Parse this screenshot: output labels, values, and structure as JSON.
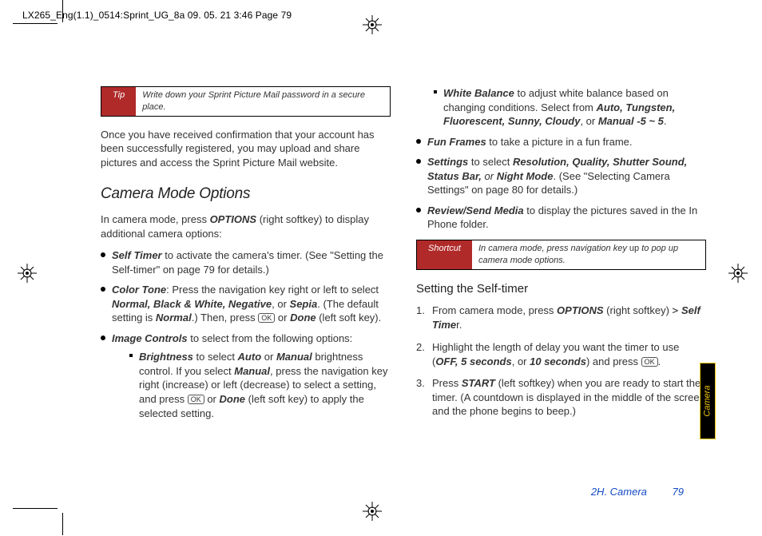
{
  "header_slug": "LX265_Eng(1.1)_0514:Sprint_UG_8a  09. 05. 21    3:46  Page 79",
  "tip": {
    "label": "Tip",
    "body": "Write down your Sprint Picture Mail password in a secure place."
  },
  "intro_para": "Once you have received confirmation that your account has been successfully registered, you may upload and share pictures and access the Sprint Picture Mail website.",
  "h2": "Camera Mode Options",
  "options_word": "OPTIONS",
  "cam_intro_a": "In camera mode, press ",
  "cam_intro_b": " (right softkey) to display additional camera options:",
  "li_selftimer_a": "Self Timer",
  "li_selftimer_b": " to activate the camera's timer. (See \"Setting the Self-timer\" on page 79 for details.)",
  "li_colortone_a": "Color Tone",
  "li_colortone_b": ": Press the navigation key right or left to select ",
  "li_colortone_c": "Normal, Black & White, Negative",
  "li_colortone_d": ", or ",
  "li_colortone_e": "Sepia",
  "li_colortone_f": ". (The default setting is ",
  "li_colortone_g": "Normal",
  "li_colortone_h": ".) Then, press ",
  "keycap_ok": "OK",
  "li_colortone_i": " or ",
  "li_colortone_j": "Done",
  "li_colortone_k": " (left soft key).",
  "li_imagecontrols_a": "Image Controls",
  "li_imagecontrols_b": " to select from the following options:",
  "sub_brightness_a": "Brightness",
  "sub_brightness_b": " to select ",
  "sub_brightness_c": "Auto",
  "sub_brightness_d": " or ",
  "sub_brightness_e": "Manual",
  "sub_brightness_f": " brightness control. If you select ",
  "sub_brightness_g": "Manual",
  "sub_brightness_h": ", press the navigation key right (increase) or left (decrease) to select a setting, and press ",
  "sub_brightness_i": " or ",
  "sub_brightness_j": "Done",
  "sub_brightness_k": " (left soft key) to apply the selected setting.",
  "sub_wb_a": "White Balance",
  "sub_wb_b": " to adjust white balance based on changing conditions. Select from ",
  "sub_wb_c": "Auto, Tungsten, Fluorescent, Sunny, Cloudy",
  "sub_wb_d": ", or ",
  "sub_wb_e": "Manual -5 ~ 5",
  "sub_wb_f": ".",
  "li_fun_a": "Fun Frames",
  "li_fun_b": " to take a picture in a fun frame.",
  "li_settings_a": "Settings",
  "li_settings_b": " to select ",
  "li_settings_c": "Resolution, Quality, Shutter Sound, Status Bar,",
  "li_settings_d": " or ",
  "li_settings_e": "Night Mode",
  "li_settings_f": ". (See \"Selecting Camera Settings\" on page 80 for details.)",
  "li_review_a": "Review/Send Media",
  "li_review_b": " to display the pictures saved in the In Phone folder.",
  "shortcut": {
    "label": "Shortcut",
    "body_a": "In camera mode, press navigation key ",
    "body_b": "up",
    "body_c": " to pop up camera mode options."
  },
  "h3": "Setting the Self-timer",
  "step1_a": "From camera mode, press ",
  "step1_b": " (right softkey) ",
  "step1_c": "Self Time",
  "step1_d": "r.",
  "step2_a": "Highlight the length of delay you want the timer to use (",
  "step2_b": "OFF, 5 seconds",
  "step2_c": ", or ",
  "step2_d": "10 seconds",
  "step2_e": ") and press ",
  "step2_f": ".",
  "step3_a": "Press ",
  "step3_b": "START",
  "step3_c": " (left softkey) when you are ready to start the timer. (A countdown is displayed in the middle of the screen and the phone begins to beep.)",
  "footer_section": "2H. Camera",
  "footer_page": "79",
  "tab_label": "Camera"
}
